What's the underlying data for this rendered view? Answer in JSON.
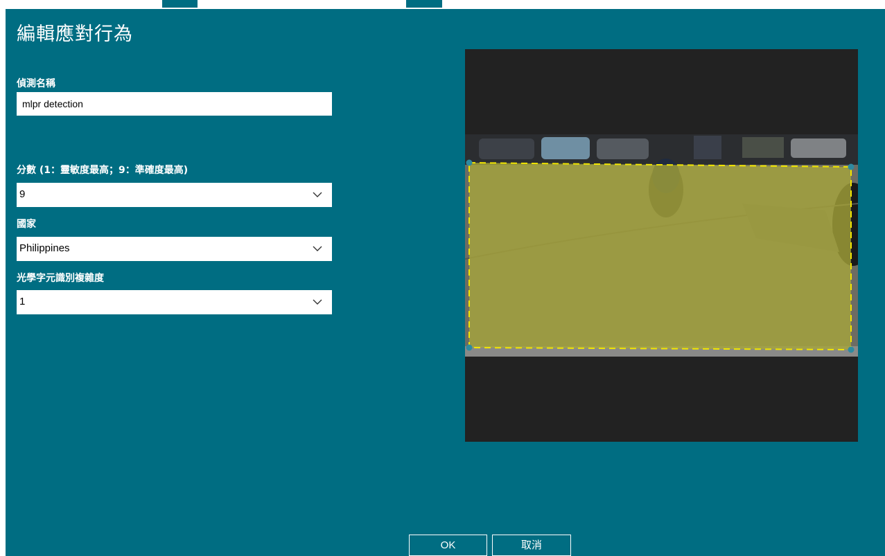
{
  "dialog": {
    "title": "編輯應對行為"
  },
  "form": {
    "detection_name": {
      "label": "偵測名稱",
      "value": "mlpr detection"
    },
    "score": {
      "label": "分數 (1：靈敏度最高；9：準確度最高)",
      "value": "9"
    },
    "country": {
      "label": "國家",
      "value": "Philippines"
    },
    "ocr_complexity": {
      "label": "光學字元識別複雜度",
      "value": "1"
    }
  },
  "buttons": {
    "ok": "OK",
    "cancel": "取消"
  },
  "colors": {
    "dialog_background": "#006d82",
    "preview_background": "#222222",
    "region_fill": "#a8a63a",
    "region_border": "#f2e600",
    "handle": "#2f8aa0"
  },
  "icons": {
    "dropdown": "chevron-down-icon"
  }
}
